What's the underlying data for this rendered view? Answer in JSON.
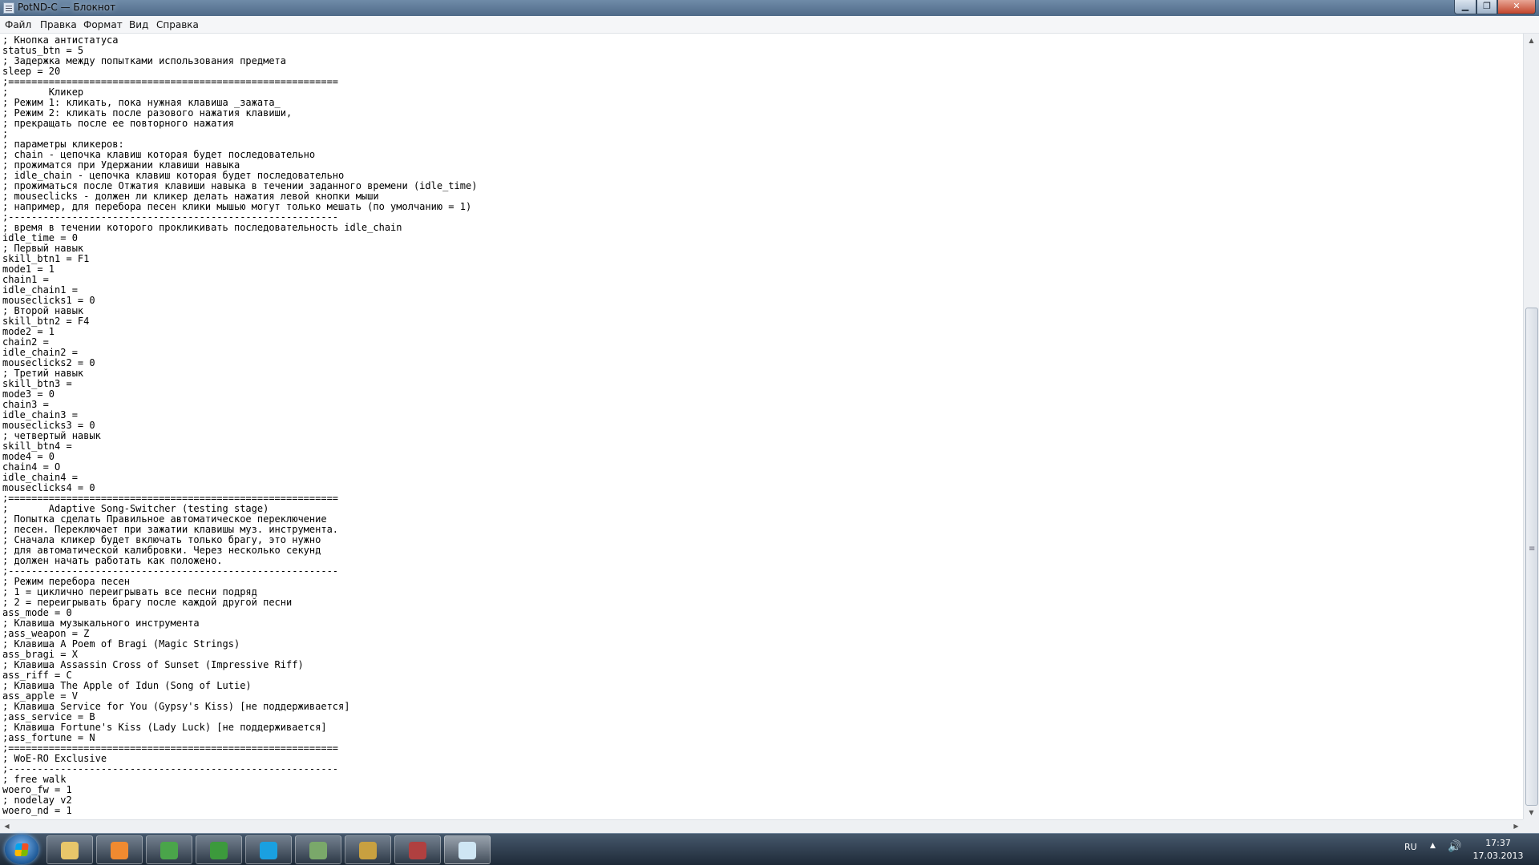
{
  "window": {
    "title": "PotND-C — Блокнот",
    "minimize_glyph": "▁",
    "maximize_glyph": "❐",
    "close_glyph": "✕"
  },
  "menu": [
    "Файл",
    "Правка",
    "Формат",
    "Вид",
    "Справка"
  ],
  "editor": {
    "lines": [
      "; Кнопка антистатуса",
      "status_btn = 5",
      "; Задержка между попытками использования предмета",
      "sleep = 20",
      ";=========================================================",
      ";       Кликер",
      "; Режим 1: кликать, пока нужная клавиша _зажата_",
      "; Режим 2: кликать после разового нажатия клавиши,",
      "; прекращать после ее повторного нажатия",
      ";",
      "; параметры кликеров:",
      "; chain - цепочка клавиш которая будет последовательно",
      "; прожиматся при Удержании клавиши навыка",
      "; idle_chain - цепочка клавиш которая будет последовательно",
      "; прожиматься после Отжатия клавиши навыка в течении заданного времени (idle_time)",
      "; mouseclicks - должен ли кликер делать нажатия левой кнопки мыши",
      "; например, для перебора песен клики мышью могут только мешать (по умолчанию = 1)",
      ";---------------------------------------------------------",
      "; время в течении которого прокликивать последовательность idle_chain",
      "idle_time = 0",
      "; Первый навык",
      "skill_btn1 = F1",
      "mode1 = 1",
      "chain1 =",
      "idle_chain1 =",
      "mouseclicks1 = 0",
      "; Второй навык",
      "skill_btn2 = F4",
      "mode2 = 1",
      "chain2 =",
      "idle_chain2 =",
      "mouseclicks2 = 0",
      "; Третий навык",
      "skill_btn3 =",
      "mode3 = 0",
      "chain3 =",
      "idle_chain3 =",
      "mouseclicks3 = 0",
      "; четвертый навык",
      "skill_btn4 =",
      "mode4 = 0",
      "chain4 = O",
      "idle_chain4 =",
      "mouseclicks4 = 0",
      ";=========================================================",
      ";       Adaptive Song-Switcher (testing stage)",
      "; Попытка сделать Правильное автоматическое переключение",
      "; песен. Переключает при зажатии клавишы муз. инструмента.",
      "; Сначала кликер будет включать только брагу, это нужно",
      "; для автоматической калибровки. Через несколько секунд",
      "; должен начать работать как положено.",
      ";---------------------------------------------------------",
      "; Режим перебора песен",
      "; 1 = циклично переигрывать все песни подряд",
      "; 2 = переигрывать брагу после каждой другой песни",
      "ass_mode = 0",
      "; Клавиша музыкального инструмента",
      ";ass_weapon = Z",
      "; Клавиша A Poem of Bragi (Magic Strings)",
      "ass_bragi = X",
      "; Клавиша Assassin Cross of Sunset (Impressive Riff)",
      "ass_riff = C",
      "; Клавиша The Apple of Idun (Song of Lutie)",
      "ass_apple = V",
      "; Клавиша Service for You (Gypsy's Kiss) [не поддерживается]",
      ";ass_service = B",
      "; Клавиша Fortune's Kiss (Lady Luck) [не поддерживается]",
      ";ass_fortune = N",
      ";=========================================================",
      "; WoE-RO Exclusive",
      ";---------------------------------------------------------",
      "; free walk",
      "woero_fw = 1",
      "; nodelay v2",
      "woero_nd = 1"
    ]
  },
  "taskbar": {
    "language": "RU",
    "time": "17:37",
    "date": "17.03.2013",
    "apps": [
      {
        "name": "explorer",
        "color": "#e8c66a"
      },
      {
        "name": "media-player",
        "color": "#f08a30"
      },
      {
        "name": "chrome",
        "color": "#4aa54a"
      },
      {
        "name": "utorrent",
        "color": "#3c9a3c"
      },
      {
        "name": "skype",
        "color": "#1aa0e0"
      },
      {
        "name": "game-launcher",
        "color": "#7aa86a"
      },
      {
        "name": "league-of-legends",
        "color": "#c8a040"
      },
      {
        "name": "game-client",
        "color": "#b04040"
      },
      {
        "name": "notepad",
        "color": "#cfe6f4"
      }
    ]
  }
}
